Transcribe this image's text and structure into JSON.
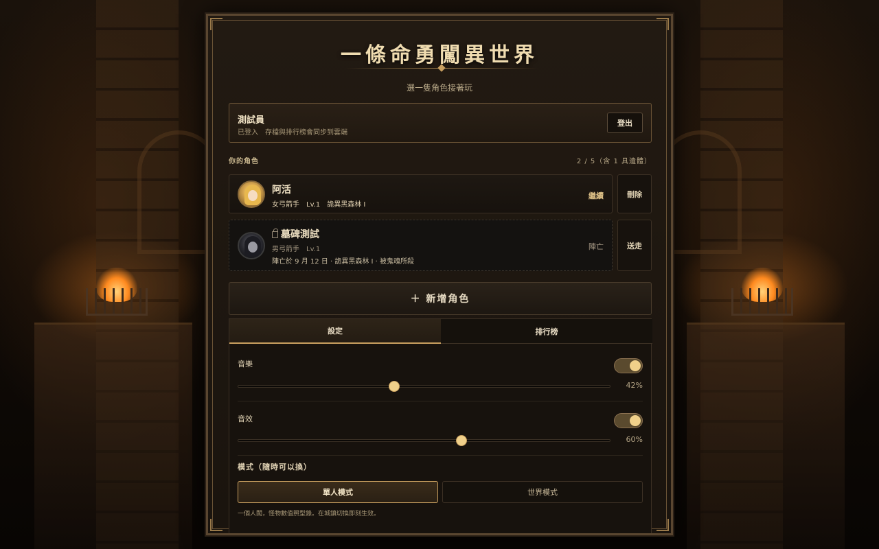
{
  "header": {
    "title": "一條命勇闖異世界",
    "subtitle": "選一隻角色接著玩"
  },
  "account": {
    "name": "測試員",
    "status": "已登入　存檔與排行榜會同步到雲端",
    "logout_label": "登出"
  },
  "roster": {
    "heading": "你的角色",
    "count": "2 / 5（含 1 具遺體）",
    "characters": [
      {
        "name": "阿活",
        "meta": "女弓箭手　Lv.1　詭異黑森林 I",
        "action": "繼續",
        "side_action": "刪除",
        "state": "alive"
      },
      {
        "name": "墓碑測試",
        "class_level": "男弓箭手　Lv.1",
        "death_note": "陣亡於 9 月 12 日 · 詭異黑森林 I · 被鬼魂所殺",
        "action": "陣亡",
        "side_action": "送走",
        "state": "dead"
      }
    ],
    "new_label": "＋ 新增角色"
  },
  "tabs": [
    {
      "label": "設定",
      "active": true
    },
    {
      "label": "排行榜",
      "active": false
    }
  ],
  "settings": {
    "music": {
      "label": "音樂",
      "enabled": true,
      "level": 42,
      "level_text": "42%"
    },
    "sfx": {
      "label": "音效",
      "enabled": true,
      "level": 60,
      "level_text": "60%"
    },
    "mode": {
      "title": "模式（隨時可以換）",
      "options": [
        "單人模式",
        "世界模式"
      ],
      "selected": "單人模式",
      "note": "一個人闖，怪物數值照型錄。在城鎮切換即刻生效。"
    }
  },
  "colors": {
    "accent": "#c9a060",
    "panel_bg": "#1a140e",
    "toggle_knob": "#f0d08a"
  }
}
